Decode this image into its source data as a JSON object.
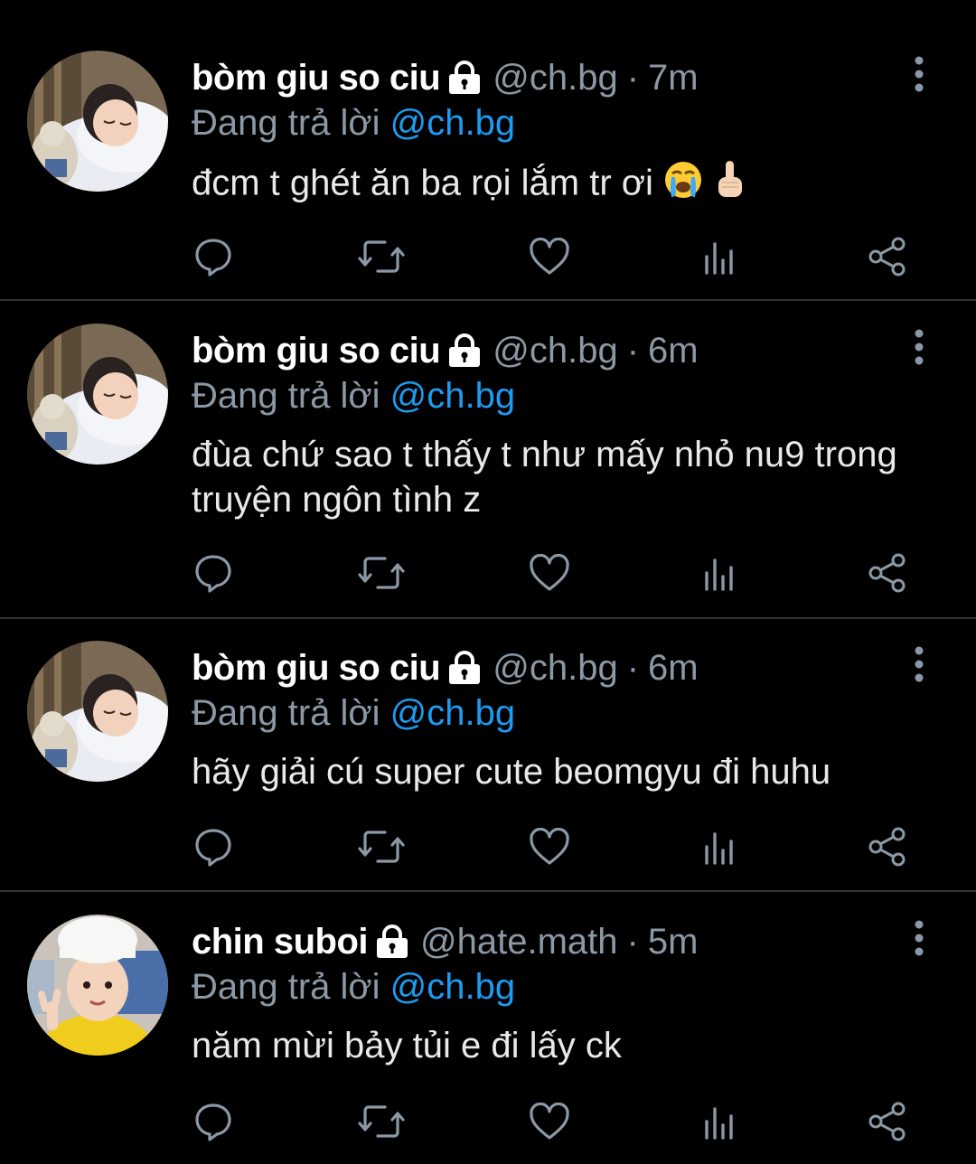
{
  "colors": {
    "background": "#000000",
    "divider": "#2f3336",
    "name": "#ffffff",
    "muted": "#8b98a5",
    "mention": "#1d9bf0",
    "icon": "#8b98a5"
  },
  "tweets": [
    {
      "name": "bòm giu so ciu",
      "protected_icon": "lock-icon",
      "handle": "@ch.bg",
      "separator": "·",
      "time": "7m",
      "reply_prefix": "Đang trả lời",
      "reply_to": "@ch.bg",
      "text": "đcm t ghét ăn ba rọi lắm tr ơi",
      "emojis": [
        "loudly-crying-face-icon",
        "hand-pointing-up-icon"
      ],
      "avatar": "sleeping-child-avatar"
    },
    {
      "name": "bòm giu so ciu",
      "protected_icon": "lock-icon",
      "handle": "@ch.bg",
      "separator": "·",
      "time": "6m",
      "reply_prefix": "Đang trả lời",
      "reply_to": "@ch.bg",
      "text": "đùa chứ sao t thấy t như mấy nhỏ nu9 trong truyện ngôn tình z",
      "avatar": "sleeping-child-avatar"
    },
    {
      "name": "bòm giu so ciu",
      "protected_icon": "lock-icon",
      "handle": "@ch.bg",
      "separator": "·",
      "time": "6m",
      "reply_prefix": "Đang trả lời",
      "reply_to": "@ch.bg",
      "text": "hãy giải cú super cute beomgyu đi huhu",
      "avatar": "sleeping-child-avatar"
    },
    {
      "name": "chin suboi",
      "protected_icon": "lock-icon",
      "handle": "@hate.math",
      "separator": "·",
      "time": "5m",
      "reply_prefix": "Đang trả lời",
      "reply_to": "@ch.bg",
      "text": "năm mừi bảy tủi e đi lấy ck",
      "avatar": "child-chef-hat-avatar"
    }
  ],
  "actions": [
    "reply-icon",
    "retweet-icon",
    "like-icon",
    "views-icon",
    "share-icon"
  ],
  "more_icon": "more-vertical-icon"
}
